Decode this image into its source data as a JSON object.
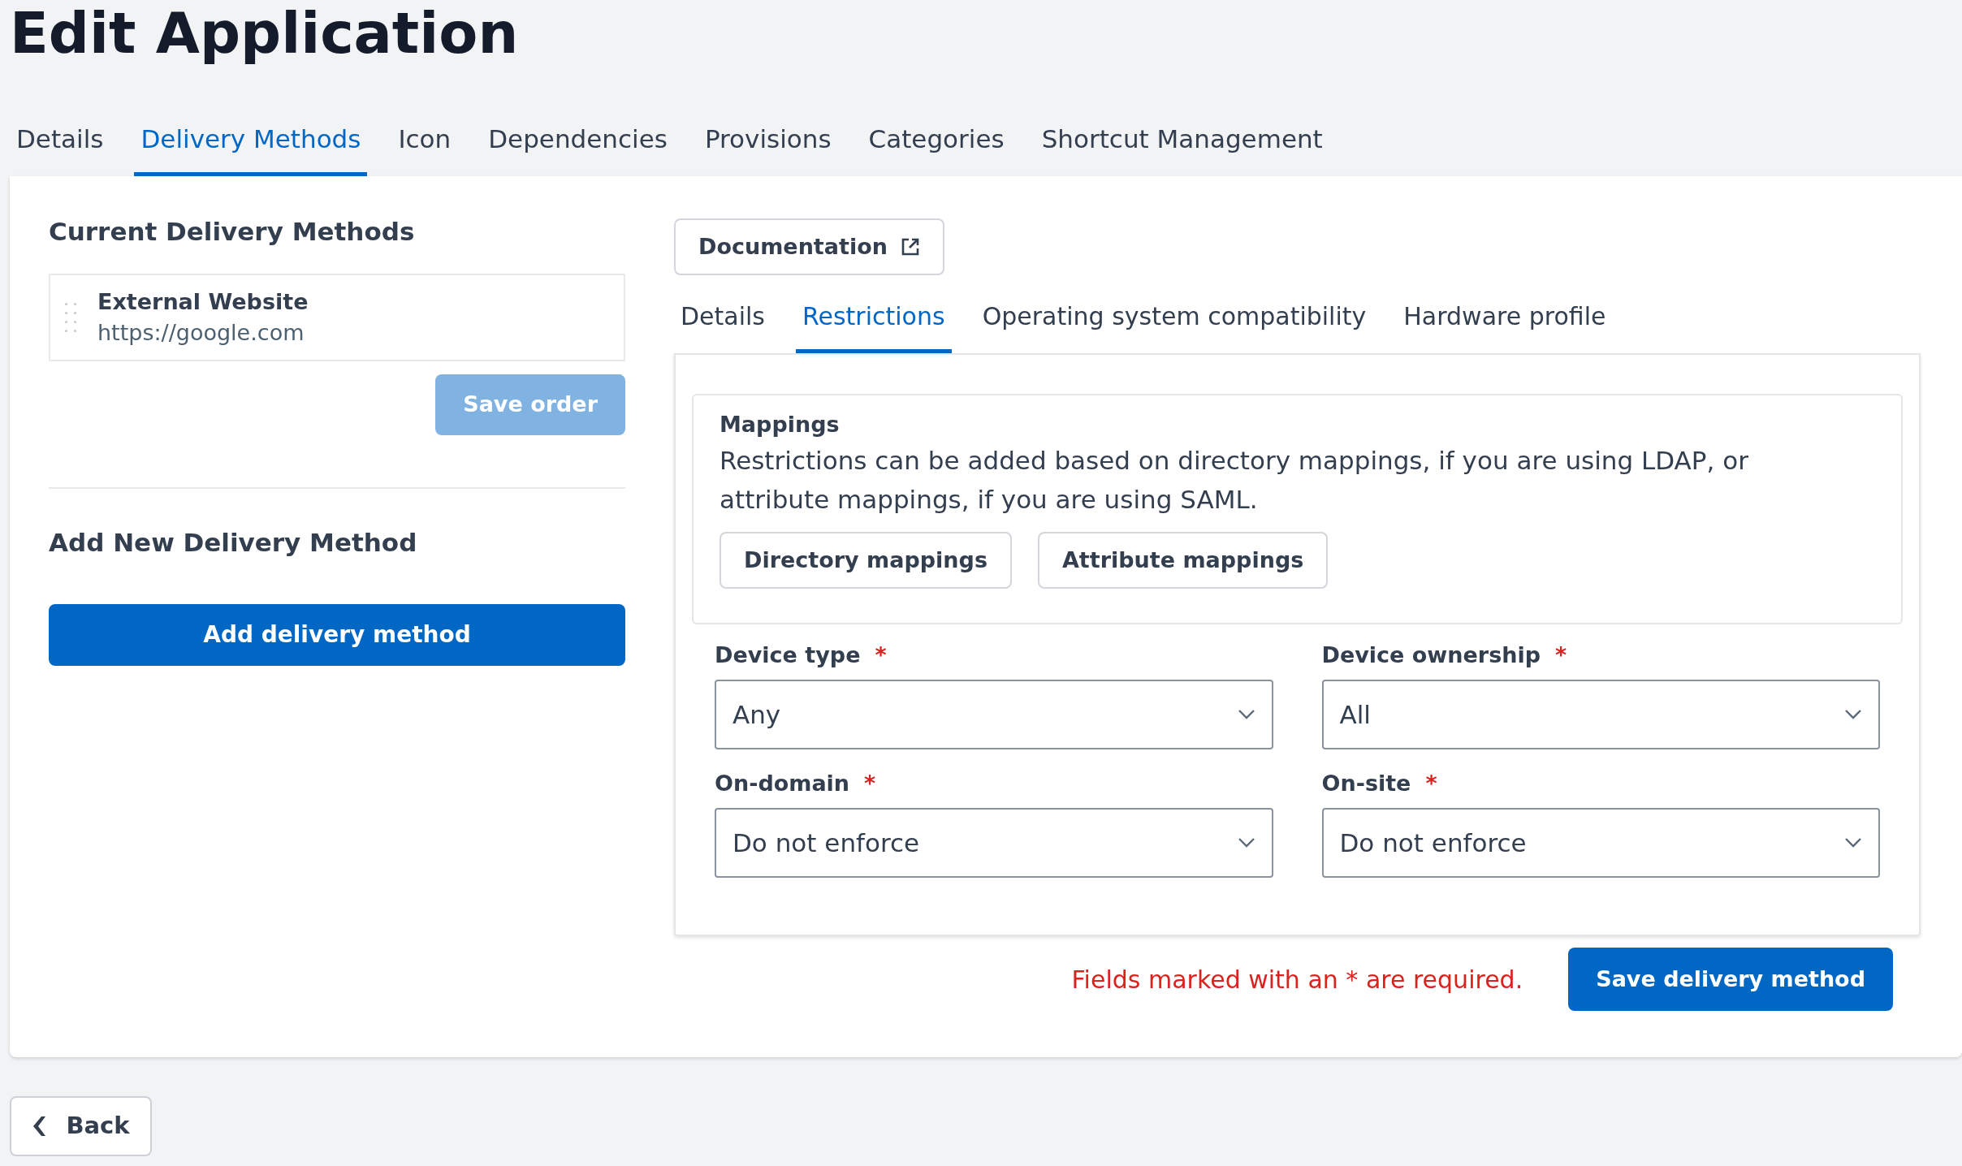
{
  "page_title": "Edit Application",
  "tabs": [
    {
      "label": "Details",
      "selected": false
    },
    {
      "label": "Delivery Methods",
      "selected": true
    },
    {
      "label": "Icon",
      "selected": false
    },
    {
      "label": "Dependencies",
      "selected": false
    },
    {
      "label": "Provisions",
      "selected": false
    },
    {
      "label": "Categories",
      "selected": false
    },
    {
      "label": "Shortcut Management",
      "selected": false
    }
  ],
  "current_methods": {
    "heading": "Current Delivery Methods",
    "items": [
      {
        "name": "External Website",
        "url": "https://google.com"
      }
    ],
    "save_order": {
      "label": "Save order",
      "disabled": true
    }
  },
  "add_new": {
    "heading": "Add New Delivery Method",
    "button": "Add delivery method"
  },
  "documentation_button": "Documentation",
  "subtabs": [
    {
      "label": "Details",
      "selected": false
    },
    {
      "label": "Restrictions",
      "selected": true
    },
    {
      "label": "Operating system compatibility",
      "selected": false
    },
    {
      "label": "Hardware profile",
      "selected": false
    }
  ],
  "mappings": {
    "title": "Mappings",
    "description": "Restrictions can be added based on directory mappings, if you are using LDAP, or attribute mappings, if you are using SAML.",
    "buttons": [
      "Directory mappings",
      "Attribute mappings"
    ]
  },
  "fields": [
    {
      "label": "Device type",
      "required_mark": "*",
      "value": "Any"
    },
    {
      "label": "Device ownership",
      "required_mark": "*",
      "value": "All"
    },
    {
      "label": "On-domain",
      "required_mark": "*",
      "value": "Do not enforce"
    },
    {
      "label": "On-site",
      "required_mark": "*",
      "value": "Do not enforce"
    }
  ],
  "required_note": "Fields marked with an * are required.",
  "save_button": "Save delivery method",
  "back_button": "Back"
}
